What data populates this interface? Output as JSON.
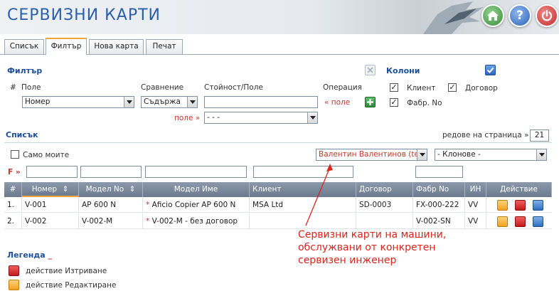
{
  "app": {
    "title": "СЕРВИЗНИ КАРТИ"
  },
  "tabs": [
    {
      "label": "Списък"
    },
    {
      "label": "Филтър"
    },
    {
      "label": "Нова карта"
    },
    {
      "label": "Печат"
    }
  ],
  "filter": {
    "section_title": "Филтър",
    "col_hash": "#",
    "col_field": "Поле",
    "col_compare": "Сравнение",
    "col_value": "Стойност/Поле",
    "col_operation": "Операция",
    "field_value": "Номер",
    "compare_value": "Съдържа",
    "value_input": "",
    "field_link": "поле »",
    "field_select": "- - -",
    "add_field_link": "« поле"
  },
  "columns": {
    "section_title": "Колони",
    "items": [
      {
        "label": "Клиент",
        "checked": true
      },
      {
        "label": "Договор",
        "checked": true
      },
      {
        "label": "Фабр. No",
        "checked": true
      }
    ]
  },
  "list": {
    "section_title": "Списък",
    "rows_per_page_label": "редове на страница »",
    "rows_per_page_value": "21",
    "only_mine_label": "Само моите",
    "engineer_select": "Валентин Валентинов (test",
    "branches_select": "- Клонове -",
    "filter_marker": "F »"
  },
  "table": {
    "headers": [
      "#",
      "Номер",
      "Модел No",
      "Модел Име",
      "Клиент",
      "Договор",
      "Фабр No",
      "ИН",
      "Действие"
    ],
    "rows": [
      {
        "num": "1.",
        "number": "V-001",
        "model_no": "AP 600 N",
        "model_name": "Aficio Copier AP 600 N",
        "client": "MSA Ltd",
        "contract": "SD-0003",
        "serial": "FX-000-222",
        "in": "VV"
      },
      {
        "num": "2.",
        "number": "V-002",
        "model_no": "V-002-M",
        "model_name": "V-002-M - без договор",
        "client": "",
        "contract": "",
        "serial": "V-002-SN",
        "in": "VV"
      }
    ]
  },
  "annotation": {
    "line1": "Сервизни карти на машини,",
    "line2": "обслужвани от конкретен",
    "line3": "сервизен инженер"
  },
  "legend": {
    "title": "Легенда",
    "items": [
      {
        "label": "действие Изтриване",
        "icon": "delete-icon"
      },
      {
        "label": "действие Редактиране",
        "icon": "edit-icon"
      }
    ]
  }
}
